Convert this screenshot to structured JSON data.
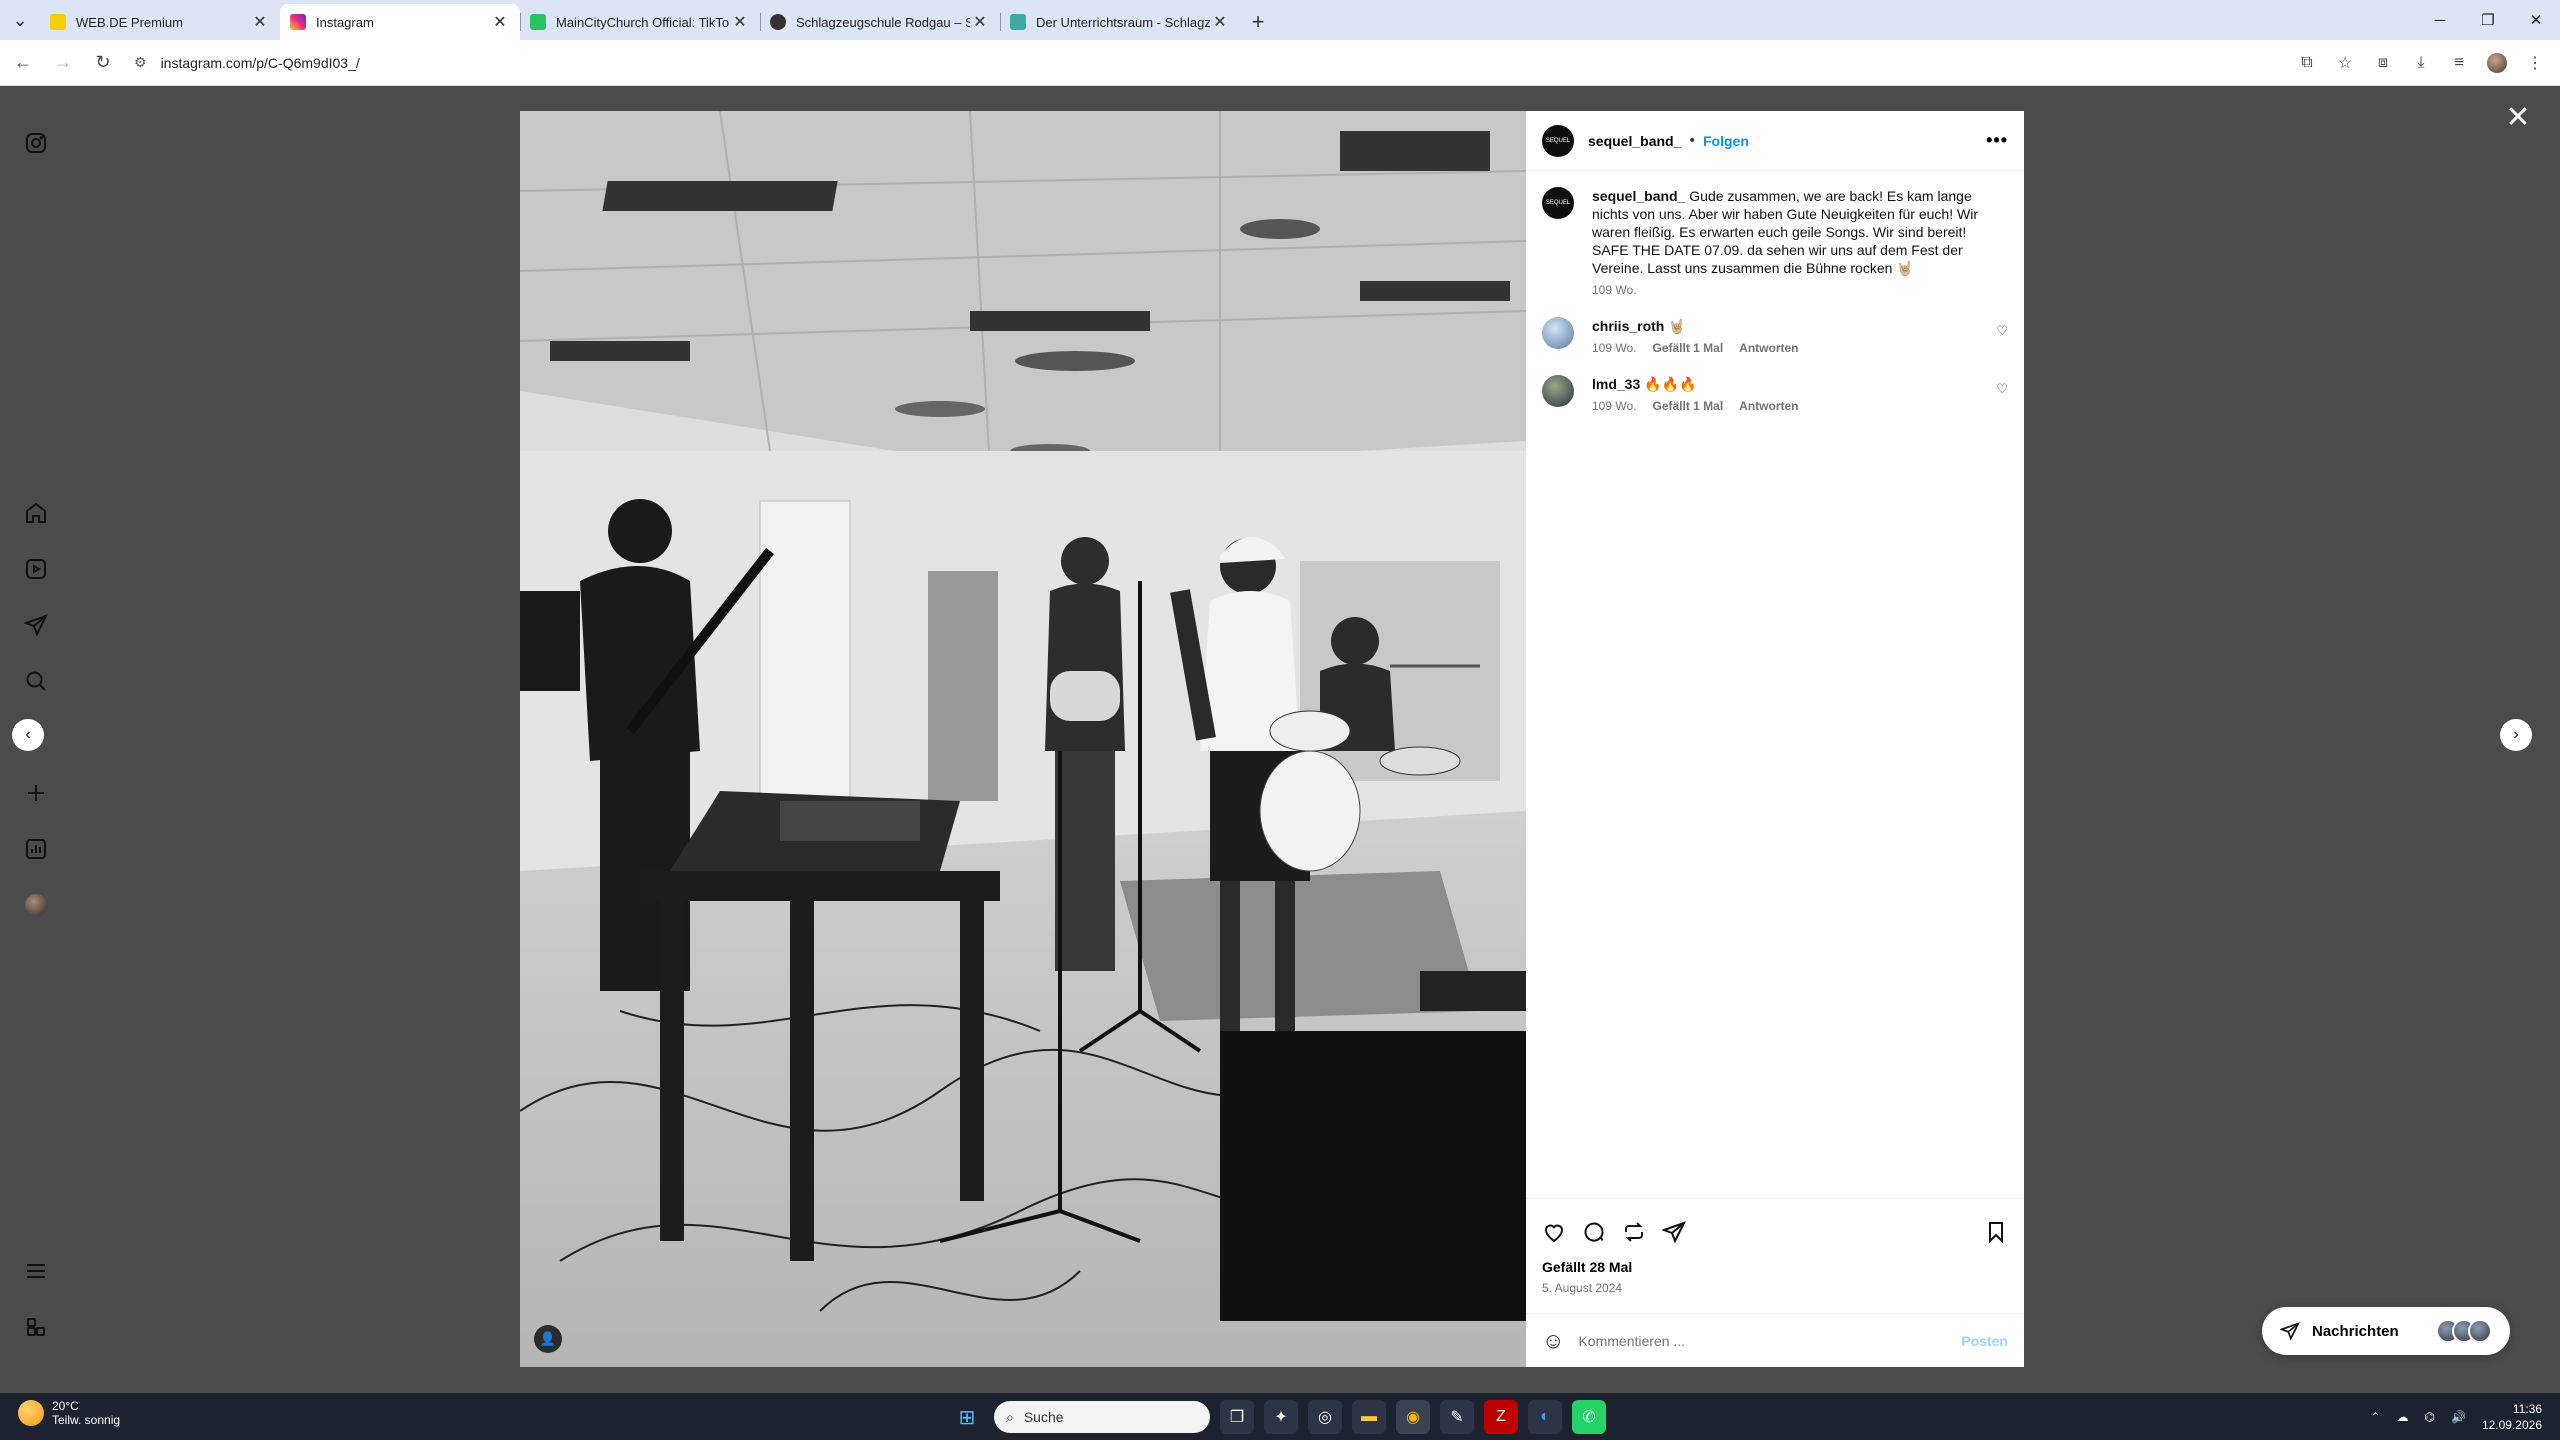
{
  "browser": {
    "tabs": [
      {
        "title": "WEB.DE Premium",
        "favicon_color": "#f5d000",
        "active": false
      },
      {
        "title": "Instagram",
        "favicon_color": "#e1306c",
        "active": true
      },
      {
        "title": "MainCityChurch Official: TikTok",
        "favicon_color": "#25c461",
        "active": false
      },
      {
        "title": "Schlagzeugschule Rodgau – Sch",
        "favicon_color": "#333333",
        "active": false
      },
      {
        "title": "Der Unterrichtsraum - Schlagze",
        "favicon_color": "#3aa9a0",
        "active": false
      }
    ],
    "url": "instagram.com/p/C-Q6m9dI03_/"
  },
  "post": {
    "username": "sequel_band_",
    "avatar_text": "SEQUEL",
    "separator": "•",
    "follow_label": "Folgen",
    "more_label": "•••",
    "caption": "Gude zusammen, we are back! Es kam lange nichts von uns. Aber wir haben Gute Neuigkeiten für euch! Wir waren fleißig. Es erwarten euch geile Songs. Wir sind bereit! SAFE THE DATE 07.09. da sehen wir uns auf dem Fest der Vereine. Lasst uns zusammen die Bühne rocken 🤘🏼",
    "caption_time": "109 Wo.",
    "comments": [
      {
        "user": "chriis_roth",
        "text": "🤘🏼",
        "time": "109 Wo.",
        "likes": "Gefällt 1 Mal",
        "reply": "Antworten"
      },
      {
        "user": "lmd_33",
        "text": "🔥🔥🔥",
        "time": "109 Wo.",
        "likes": "Gefällt 1 Mal",
        "reply": "Antworten"
      }
    ],
    "likes": "Gefällt 28 Mal",
    "date": "5. August 2024",
    "comment_placeholder": "Kommentieren ...",
    "post_label": "Posten"
  },
  "messages": {
    "label": "Nachrichten"
  },
  "taskbar": {
    "temperature": "20°C",
    "weather": "Teilw. sonnig",
    "search_placeholder": "Suche",
    "time": "11:36",
    "date": "12.09.2026"
  },
  "icons": [
    "instagram-icon",
    "home-icon",
    "reels-icon",
    "direct-icon",
    "search-icon",
    "create-icon",
    "insights-icon",
    "more-icon",
    "threads-icon",
    "heart-icon",
    "comment-icon",
    "repost-icon",
    "share-icon",
    "bookmark-icon",
    "emoji-icon",
    "close-icon"
  ]
}
